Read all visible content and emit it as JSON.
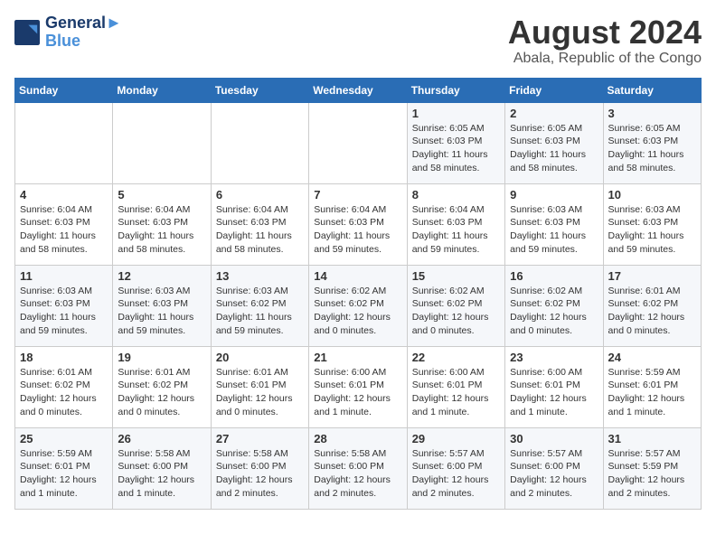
{
  "logo": {
    "line1": "General",
    "line2": "Blue"
  },
  "title": "August 2024",
  "subtitle": "Abala, Republic of the Congo",
  "days_of_week": [
    "Sunday",
    "Monday",
    "Tuesday",
    "Wednesday",
    "Thursday",
    "Friday",
    "Saturday"
  ],
  "weeks": [
    [
      {
        "day": "",
        "info": ""
      },
      {
        "day": "",
        "info": ""
      },
      {
        "day": "",
        "info": ""
      },
      {
        "day": "",
        "info": ""
      },
      {
        "day": "1",
        "info": "Sunrise: 6:05 AM\nSunset: 6:03 PM\nDaylight: 11 hours\nand 58 minutes."
      },
      {
        "day": "2",
        "info": "Sunrise: 6:05 AM\nSunset: 6:03 PM\nDaylight: 11 hours\nand 58 minutes."
      },
      {
        "day": "3",
        "info": "Sunrise: 6:05 AM\nSunset: 6:03 PM\nDaylight: 11 hours\nand 58 minutes."
      }
    ],
    [
      {
        "day": "4",
        "info": "Sunrise: 6:04 AM\nSunset: 6:03 PM\nDaylight: 11 hours\nand 58 minutes."
      },
      {
        "day": "5",
        "info": "Sunrise: 6:04 AM\nSunset: 6:03 PM\nDaylight: 11 hours\nand 58 minutes."
      },
      {
        "day": "6",
        "info": "Sunrise: 6:04 AM\nSunset: 6:03 PM\nDaylight: 11 hours\nand 58 minutes."
      },
      {
        "day": "7",
        "info": "Sunrise: 6:04 AM\nSunset: 6:03 PM\nDaylight: 11 hours\nand 59 minutes."
      },
      {
        "day": "8",
        "info": "Sunrise: 6:04 AM\nSunset: 6:03 PM\nDaylight: 11 hours\nand 59 minutes."
      },
      {
        "day": "9",
        "info": "Sunrise: 6:03 AM\nSunset: 6:03 PM\nDaylight: 11 hours\nand 59 minutes."
      },
      {
        "day": "10",
        "info": "Sunrise: 6:03 AM\nSunset: 6:03 PM\nDaylight: 11 hours\nand 59 minutes."
      }
    ],
    [
      {
        "day": "11",
        "info": "Sunrise: 6:03 AM\nSunset: 6:03 PM\nDaylight: 11 hours\nand 59 minutes."
      },
      {
        "day": "12",
        "info": "Sunrise: 6:03 AM\nSunset: 6:03 PM\nDaylight: 11 hours\nand 59 minutes."
      },
      {
        "day": "13",
        "info": "Sunrise: 6:03 AM\nSunset: 6:02 PM\nDaylight: 11 hours\nand 59 minutes."
      },
      {
        "day": "14",
        "info": "Sunrise: 6:02 AM\nSunset: 6:02 PM\nDaylight: 12 hours\nand 0 minutes."
      },
      {
        "day": "15",
        "info": "Sunrise: 6:02 AM\nSunset: 6:02 PM\nDaylight: 12 hours\nand 0 minutes."
      },
      {
        "day": "16",
        "info": "Sunrise: 6:02 AM\nSunset: 6:02 PM\nDaylight: 12 hours\nand 0 minutes."
      },
      {
        "day": "17",
        "info": "Sunrise: 6:01 AM\nSunset: 6:02 PM\nDaylight: 12 hours\nand 0 minutes."
      }
    ],
    [
      {
        "day": "18",
        "info": "Sunrise: 6:01 AM\nSunset: 6:02 PM\nDaylight: 12 hours\nand 0 minutes."
      },
      {
        "day": "19",
        "info": "Sunrise: 6:01 AM\nSunset: 6:02 PM\nDaylight: 12 hours\nand 0 minutes."
      },
      {
        "day": "20",
        "info": "Sunrise: 6:01 AM\nSunset: 6:01 PM\nDaylight: 12 hours\nand 0 minutes."
      },
      {
        "day": "21",
        "info": "Sunrise: 6:00 AM\nSunset: 6:01 PM\nDaylight: 12 hours\nand 1 minute."
      },
      {
        "day": "22",
        "info": "Sunrise: 6:00 AM\nSunset: 6:01 PM\nDaylight: 12 hours\nand 1 minute."
      },
      {
        "day": "23",
        "info": "Sunrise: 6:00 AM\nSunset: 6:01 PM\nDaylight: 12 hours\nand 1 minute."
      },
      {
        "day": "24",
        "info": "Sunrise: 5:59 AM\nSunset: 6:01 PM\nDaylight: 12 hours\nand 1 minute."
      }
    ],
    [
      {
        "day": "25",
        "info": "Sunrise: 5:59 AM\nSunset: 6:01 PM\nDaylight: 12 hours\nand 1 minute."
      },
      {
        "day": "26",
        "info": "Sunrise: 5:58 AM\nSunset: 6:00 PM\nDaylight: 12 hours\nand 1 minute."
      },
      {
        "day": "27",
        "info": "Sunrise: 5:58 AM\nSunset: 6:00 PM\nDaylight: 12 hours\nand 2 minutes."
      },
      {
        "day": "28",
        "info": "Sunrise: 5:58 AM\nSunset: 6:00 PM\nDaylight: 12 hours\nand 2 minutes."
      },
      {
        "day": "29",
        "info": "Sunrise: 5:57 AM\nSunset: 6:00 PM\nDaylight: 12 hours\nand 2 minutes."
      },
      {
        "day": "30",
        "info": "Sunrise: 5:57 AM\nSunset: 6:00 PM\nDaylight: 12 hours\nand 2 minutes."
      },
      {
        "day": "31",
        "info": "Sunrise: 5:57 AM\nSunset: 5:59 PM\nDaylight: 12 hours\nand 2 minutes."
      }
    ]
  ]
}
